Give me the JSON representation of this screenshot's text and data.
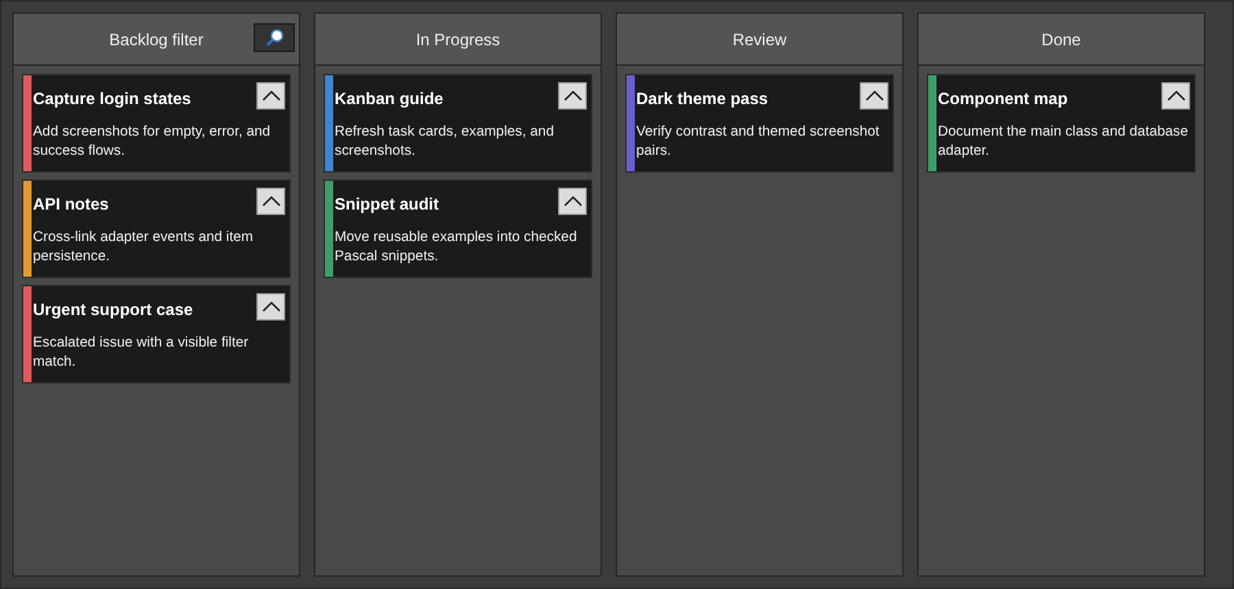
{
  "columns": [
    {
      "title": "Backlog filter",
      "filter_button": true,
      "cards": [
        {
          "title": "Capture login states",
          "description": "Add screenshots for empty, error, and success flows.",
          "color": "#e05a5a",
          "expanded": true
        },
        {
          "title": "API notes",
          "description": "Cross-link adapter events and item persistence.",
          "color": "#e39a35",
          "expanded": true
        },
        {
          "title": "Urgent support case",
          "description": "Escalated issue with a visible filter match.",
          "color": "#e05a5a",
          "expanded": true
        }
      ]
    },
    {
      "title": "In Progress",
      "filter_button": false,
      "cards": [
        {
          "title": "Kanban guide",
          "description": "Refresh task cards, examples, and screenshots.",
          "color": "#3f86d1",
          "expanded": true
        },
        {
          "title": "Snippet audit",
          "description": "Move reusable examples into checked Pascal snippets.",
          "color": "#3e9e6a",
          "expanded": true
        }
      ]
    },
    {
      "title": "Review",
      "filter_button": false,
      "cards": [
        {
          "title": "Dark theme pass",
          "description": "Verify contrast and themed screenshot pairs.",
          "color": "#6a5fd0",
          "expanded": true
        }
      ]
    },
    {
      "title": "Done",
      "filter_button": false,
      "cards": [
        {
          "title": "Component map",
          "description": "Document the main class and database adapter.",
          "color": "#3e9e6a",
          "expanded": true
        }
      ]
    }
  ]
}
